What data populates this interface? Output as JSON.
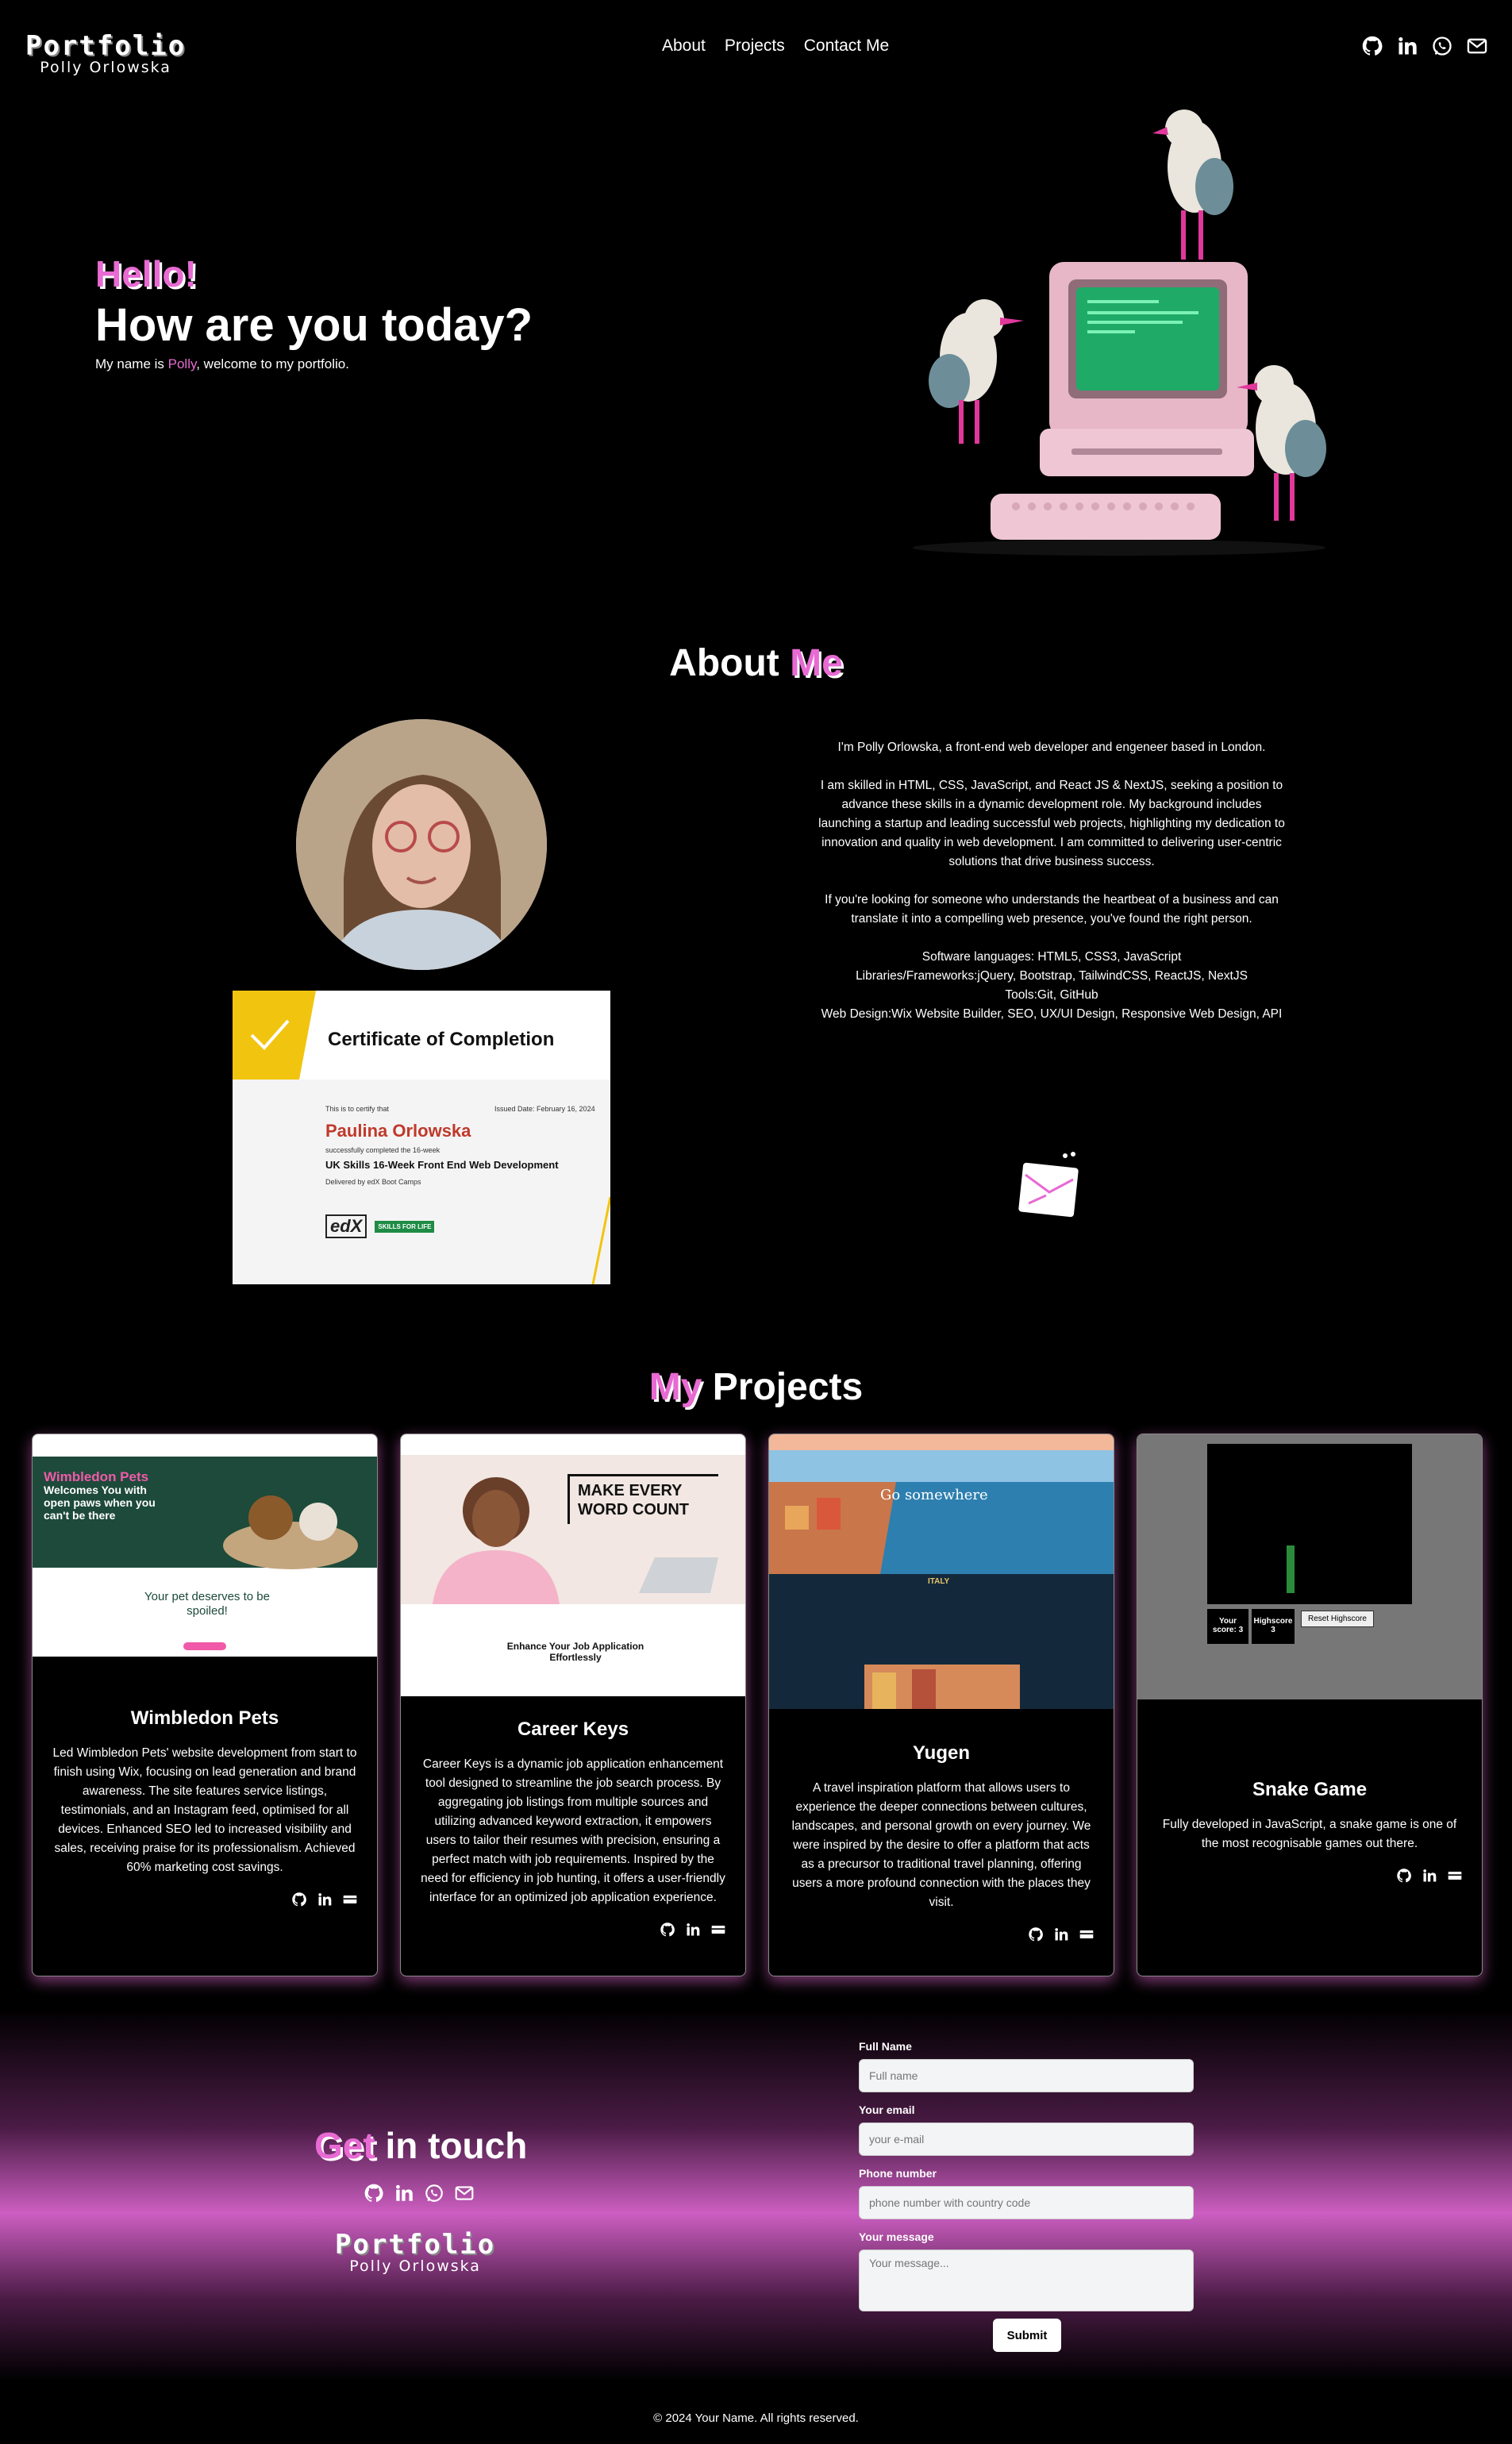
{
  "nav": {
    "logo_title": "Portfolio",
    "logo_sub": "Polly Orlowska",
    "links": [
      "About",
      "Projects",
      "Contact Me"
    ],
    "icons": [
      "github-icon",
      "linkedin-icon",
      "whatsapp-icon",
      "mail-icon"
    ]
  },
  "hero": {
    "hello": "Hello!",
    "title": "How are you today?",
    "sub_prefix": "My name is ",
    "sub_name": "Polly",
    "sub_suffix": ", welcome to my portfolio."
  },
  "about": {
    "title_plain": "About ",
    "title_accent": "Me",
    "intro": "I'm Polly Orlowska, a front-end web developer and engeneer based in London.",
    "skills_para": "I am skilled in HTML, CSS, JavaScript, and React JS & NextJS, seeking a position to advance these skills in a dynamic development role. My background includes launching a startup and leading successful web projects, highlighting my dedication to innovation and quality in web development. I am committed to delivering user-centric solutions that drive business success.",
    "pitch": "If you're looking for someone who understands the heartbeat of a business and can translate it into a compelling web presence, you've found the right person.",
    "software": "Software languages: HTML5, CSS3, JavaScript",
    "libraries": "Libraries/Frameworks:jQuery, Bootstrap, TailwindCSS, ReactJS, NextJS",
    "tools": "Tools:Git, GitHub",
    "webdesign": "Web Design:Wix Website Builder, SEO, UX/UI Design, Responsive Web Design, API"
  },
  "certificate": {
    "heading": "Certificate of Completion",
    "certify": "This is to certify that",
    "issued": "Issued Date:  February 16, 2024",
    "name": "Paulina Orlowska",
    "completed": "successfully completed the 16-week",
    "course": "UK Skills 16-Week Front End Web Development",
    "delivered": "Delivered by edX Boot Camps",
    "edx": "edX",
    "ssl": "SKILLS FOR LIFE"
  },
  "projects": {
    "title_accent": "My",
    "title_plain": " Projects",
    "items": [
      {
        "title": "Wimbledon Pets",
        "description": "Led Wimbledon Pets' website development from start to finish using Wix, focusing on lead generation and brand awareness. The site features service listings, testimonials, and an Instagram feed, optimised for all devices. Enhanced SEO led to increased visibility and sales, receiving praise for its professionalism. Achieved 60% marketing cost savings.",
        "shot_headline": "Wimbledon Pets",
        "shot_tagline": "Welcomes You with open paws when you can't be there",
        "shot_sub": "Your pet deserves to be spoiled!"
      },
      {
        "title": "Career Keys",
        "description": "Career Keys is a dynamic job application enhancement tool designed to streamline the job search process. By aggregating job listings from multiple sources and utilizing advanced keyword extraction, it empowers users to tailor their resumes with precision, ensuring a perfect match with job requirements. Inspired by the need for efficiency in job hunting, it offers a user-friendly interface for an optimized job application experience.",
        "shot_headline": "MAKE EVERY WORD COUNT",
        "shot_sub": "Enhance Your Job Application Effortlessly"
      },
      {
        "title": "Yugen",
        "description": "A travel inspiration platform that allows users to experience the deeper connections between cultures, landscapes, and personal growth on every journey. We were inspired by the desire to offer a platform that acts as a precursor to traditional travel planning, offering users a more profound connection with the places they visit.",
        "shot_headline": "Go somewhere",
        "shot_sub": "ITALY"
      },
      {
        "title": "Snake Game",
        "description": "Fully developed in JavaScript, a snake game is one of the most recognisable games out there.",
        "score_label": "Your score: 3",
        "highscore_label": "Highscore 3",
        "reset_label": "Reset Highscore"
      }
    ]
  },
  "contact": {
    "title_accent": "Get",
    "title_plain": " in touch",
    "logo_title": "Portfolio",
    "logo_sub": "Polly Orlowska",
    "fields": {
      "name_label": "Full Name",
      "name_placeholder": "Full name",
      "email_label": "Your email",
      "email_placeholder": "your e-mail",
      "phone_label": "Phone number",
      "phone_placeholder": "phone number with country code",
      "message_label": "Your message",
      "message_placeholder": "Your message..."
    },
    "submit": "Submit"
  },
  "footer": {
    "text": "© 2024 Your Name. All rights reserved."
  },
  "colors": {
    "accent": "#e86ad3",
    "background": "#000000"
  }
}
